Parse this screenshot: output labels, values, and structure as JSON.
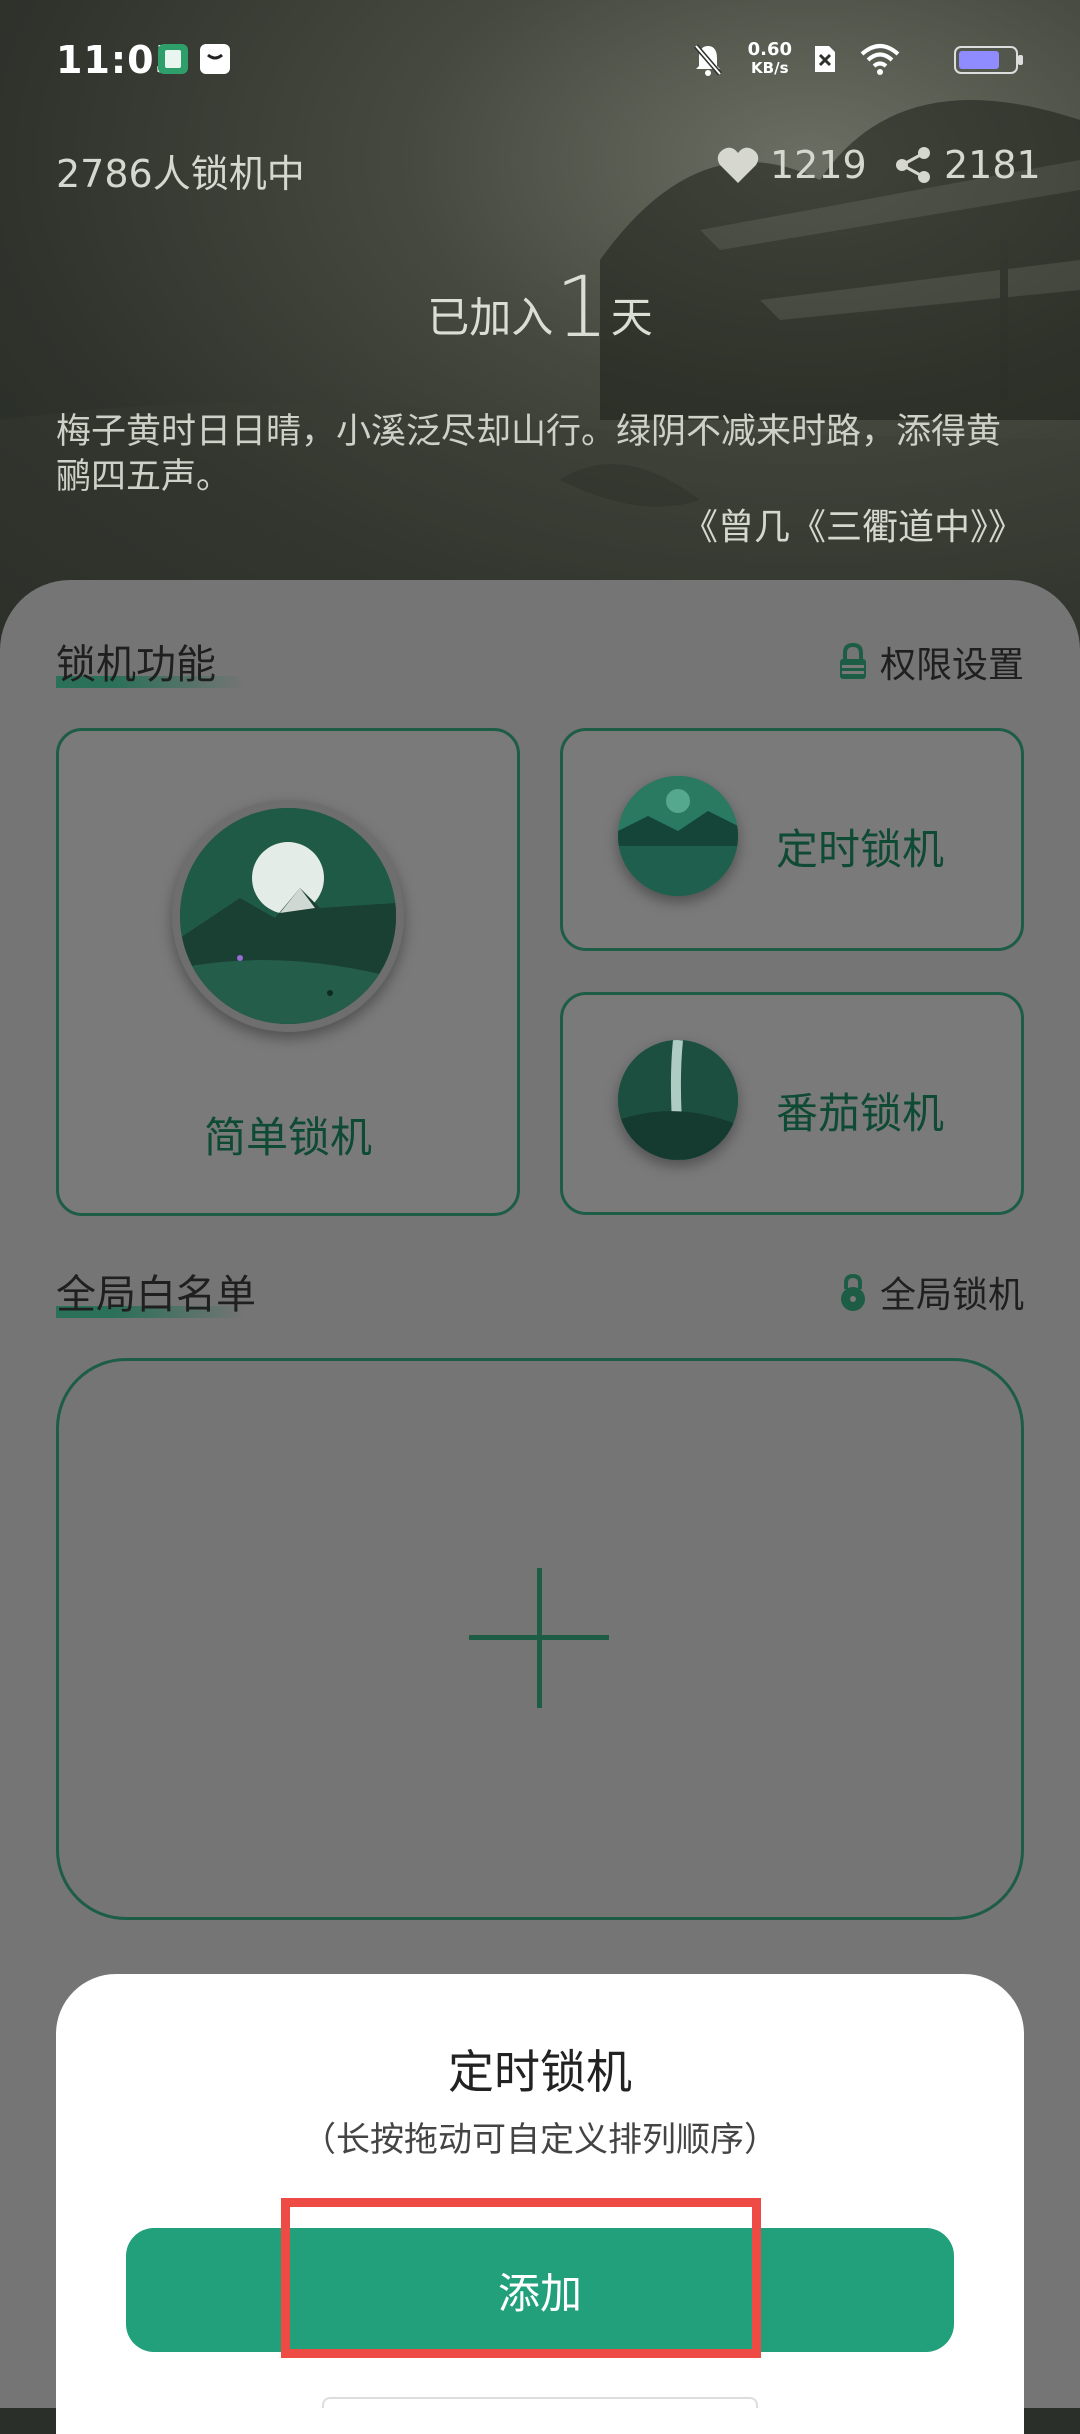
{
  "status_bar": {
    "time": "11:05",
    "net_speed_value": "0.60",
    "net_speed_unit": "KB/s",
    "icons": [
      "app-notification-icon",
      "message-icon",
      "mute-bell-icon",
      "no-sim-icon",
      "wifi-icon",
      "battery-icon"
    ]
  },
  "header": {
    "users_locking": "2786人锁机中",
    "likes": "1219",
    "shares": "2181",
    "joined_prefix": "已加入",
    "joined_days": "1",
    "joined_suffix": "天",
    "poem": "梅子黄时日日晴，小溪泛尽却山行。绿阴不减来时路，添得黄鹂四五声。",
    "poem_source": "《曾几《三衢道中》》"
  },
  "lock_section": {
    "title": "锁机功能",
    "permission_label": "权限设置",
    "cards": [
      {
        "label": "简单锁机",
        "icon": "mountain-moon-icon"
      },
      {
        "label": "定时锁机",
        "icon": "lake-scene-icon"
      },
      {
        "label": "番茄锁机",
        "icon": "waterfall-scene-icon"
      }
    ]
  },
  "whitelist_section": {
    "title": "全局白名单",
    "global_lock_label": "全局锁机",
    "add_icon": "plus-icon"
  },
  "sheet": {
    "title": "定时锁机",
    "subtitle": "（长按拖动可自定义排列顺序）",
    "add_button": "添加"
  },
  "colors": {
    "accent_green": "#21a07b",
    "dark_green": "#1d5d46",
    "highlight_red": "#ef4b45"
  }
}
